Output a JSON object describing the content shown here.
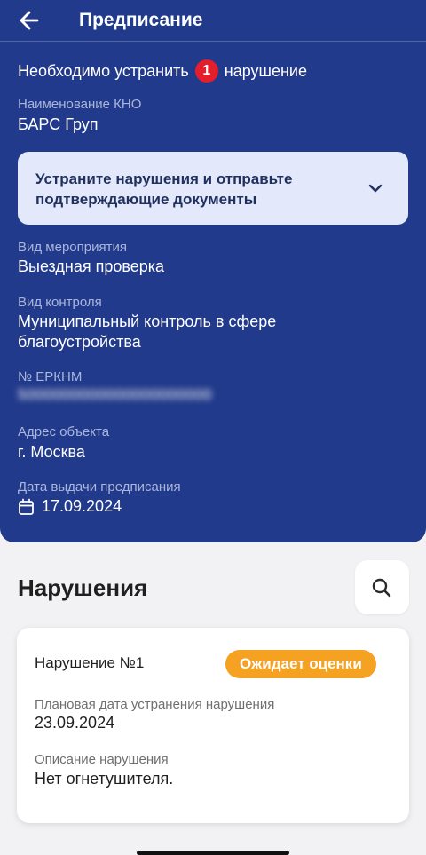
{
  "header": {
    "title": "Предписание"
  },
  "summary": {
    "prefix": "Необходимо устранить",
    "count": "1",
    "suffix": "нарушение"
  },
  "kno": {
    "label": "Наименование КНО",
    "value": "БАРС Груп"
  },
  "banner": {
    "text": "Устраните нарушения и отправьте подтверждающие документы"
  },
  "event_type": {
    "label": "Вид мероприятия",
    "value": "Выездная проверка"
  },
  "control_type": {
    "label": "Вид контроля",
    "value": "Муниципальный контроль в сфере благоустройства"
  },
  "erknm": {
    "label": "№ ЕРКНМ",
    "value": "5000000000000000000000"
  },
  "address": {
    "label": "Адрес объекта",
    "value": "г. Москва"
  },
  "issue_date": {
    "label": "Дата выдачи предписания",
    "value": "17.09.2024"
  },
  "violations": {
    "title": "Нарушения",
    "items": [
      {
        "title": "Нарушение №1",
        "status": "Ожидает оценки",
        "due_label": "Плановая дата устранения нарушения",
        "due_value": "23.09.2024",
        "desc_label": "Описание нарушения",
        "desc_value": "Нет огнетушителя."
      }
    ]
  },
  "colors": {
    "header_bg": "#223a8b",
    "badge": "#e41e2b",
    "status": "#f5a122",
    "banner_bg": "#e3e8fa"
  }
}
